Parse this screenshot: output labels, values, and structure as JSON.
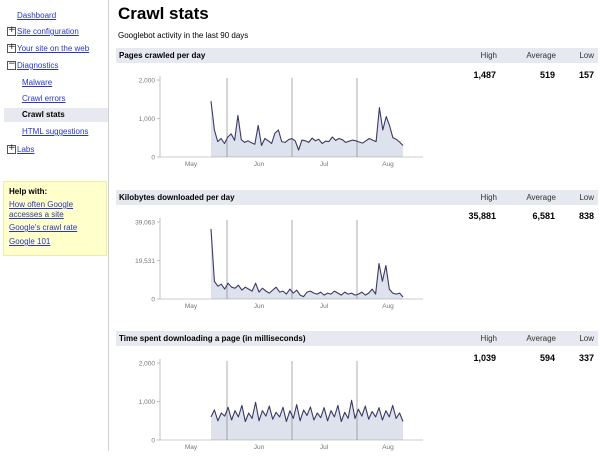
{
  "sidebar": {
    "items": [
      {
        "label": "Dashboard"
      },
      {
        "label": "Site configuration"
      },
      {
        "label": "Your site on the web"
      },
      {
        "label": "Diagnostics"
      },
      {
        "label": "Malware"
      },
      {
        "label": "Crawl errors"
      },
      {
        "label": "Crawl stats"
      },
      {
        "label": "HTML suggestions"
      },
      {
        "label": "Labs"
      }
    ],
    "help": {
      "title": "Help with:",
      "links": [
        "How often Google accesses a site",
        "Google's crawl rate",
        "Google 101"
      ]
    }
  },
  "main": {
    "title": "Crawl stats",
    "subtitle": "Googlebot activity in the last 90 days",
    "columns": {
      "high": "High",
      "average": "Average",
      "low": "Low"
    }
  },
  "colors": {
    "line": "#3a3a66",
    "fill": "#dde2ec",
    "accent": "#2a36c4",
    "panel_header": "#e6e9f0"
  },
  "chart_data": [
    {
      "type": "area",
      "title": "Pages crawled per day",
      "stats": {
        "high": "1,487",
        "average": "519",
        "low": "157"
      },
      "x_ticks": [
        "May",
        "Jun",
        "Jul",
        "Aug"
      ],
      "y_ticks": [
        "2,000",
        "1,000",
        "0"
      ],
      "ylim": [
        0,
        2000
      ],
      "values": [
        1450,
        700,
        400,
        480,
        350,
        520,
        600,
        430,
        1080,
        450,
        380,
        420,
        370,
        330,
        820,
        300,
        480,
        420,
        350,
        620,
        700,
        400,
        380,
        450,
        480,
        420,
        180,
        440,
        420,
        380,
        490,
        420,
        460,
        350,
        410,
        400,
        520,
        430,
        480,
        450,
        380,
        410,
        440,
        420,
        390,
        360,
        420,
        480,
        440,
        400,
        1280,
        700,
        1050,
        820,
        500,
        460,
        390,
        300
      ]
    },
    {
      "type": "area",
      "title": "Kilobytes downloaded per day",
      "stats": {
        "high": "35,881",
        "average": "6,581",
        "low": "838"
      },
      "x_ticks": [
        "May",
        "Jun",
        "Jul",
        "Aug"
      ],
      "y_ticks": [
        "39,063",
        "19,531",
        "0"
      ],
      "ylim": [
        0,
        39063
      ],
      "values": [
        35500,
        9000,
        6500,
        7500,
        5000,
        8000,
        6000,
        5500,
        7000,
        4500,
        6000,
        5000,
        4000,
        8000,
        3500,
        5500,
        4000,
        3000,
        4500,
        6000,
        3500,
        4000,
        2500,
        5000,
        3000,
        4500,
        2000,
        1200,
        3500,
        4000,
        3000,
        2500,
        3500,
        2000,
        3000,
        2500,
        4000,
        3000,
        2000,
        3500,
        2500,
        3000,
        2000,
        2500,
        3500,
        2000,
        3000,
        5000,
        2500,
        18000,
        9000,
        17000,
        5000,
        3000,
        2500,
        3000,
        1000
      ]
    },
    {
      "type": "area",
      "title": "Time spent downloading a page (in milliseconds)",
      "stats": {
        "high": "1,039",
        "average": "594",
        "low": "337"
      },
      "x_ticks": [
        "May",
        "Jun",
        "Jul",
        "Aug"
      ],
      "y_ticks": [
        "2,000",
        "1,000",
        "0"
      ],
      "ylim": [
        0,
        2000
      ],
      "values": [
        600,
        780,
        500,
        700,
        620,
        850,
        520,
        760,
        600,
        900,
        480,
        700,
        560,
        980,
        500,
        760,
        620,
        880,
        540,
        720,
        600,
        850,
        480,
        760,
        560,
        920,
        500,
        780,
        640,
        860,
        520,
        700,
        580,
        840,
        500,
        760,
        600,
        900,
        480,
        720,
        560,
        1030,
        560,
        800,
        620,
        880,
        540,
        740,
        600,
        840,
        520,
        760,
        600,
        900,
        560,
        700,
        480
      ]
    }
  ]
}
